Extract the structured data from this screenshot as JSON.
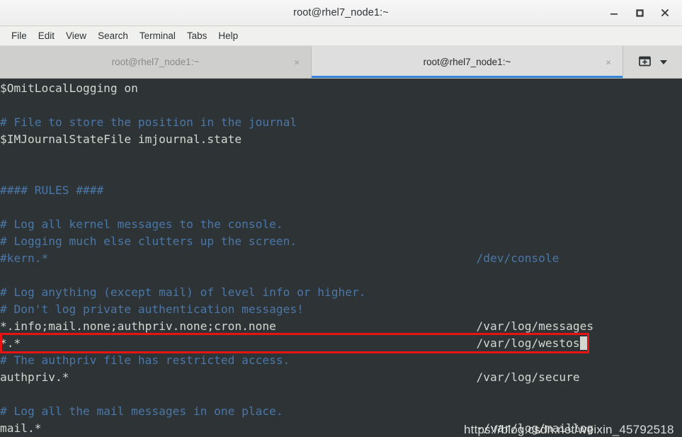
{
  "window": {
    "title": "root@rhel7_node1:~",
    "controls": {
      "minimize": "minimize",
      "maximize": "maximize",
      "close": "close"
    }
  },
  "menubar": {
    "items": [
      {
        "label": "File"
      },
      {
        "label": "Edit"
      },
      {
        "label": "View"
      },
      {
        "label": "Search"
      },
      {
        "label": "Terminal"
      },
      {
        "label": "Tabs"
      },
      {
        "label": "Help"
      }
    ]
  },
  "tabs": {
    "items": [
      {
        "label": "root@rhel7_node1:~",
        "active": false,
        "close": "×"
      },
      {
        "label": "root@rhel7_node1:~",
        "active": true,
        "close": "×"
      }
    ],
    "new_tab_icon": "new-tab-icon",
    "dropdown_icon": "chevron-down-icon"
  },
  "terminal": {
    "colors": {
      "background": "#2e3436",
      "foreground": "#d3d7cf",
      "comment": "#4a76a8",
      "highlight_border": "#e81313"
    },
    "lines": [
      {
        "left": "$OmitLocalLogging on",
        "right": "",
        "style": "white"
      },
      {
        "left": "",
        "right": "",
        "style": "white"
      },
      {
        "left": "# File to store the position in the journal",
        "right": "",
        "style": "blue"
      },
      {
        "left": "$IMJournalStateFile imjournal.state",
        "right": "",
        "style": "white"
      },
      {
        "left": "",
        "right": "",
        "style": "white"
      },
      {
        "left": "",
        "right": "",
        "style": "white"
      },
      {
        "left": "#### RULES ####",
        "right": "",
        "style": "blue"
      },
      {
        "left": "",
        "right": "",
        "style": "white"
      },
      {
        "left": "# Log all kernel messages to the console.",
        "right": "",
        "style": "blue"
      },
      {
        "left": "# Logging much else clutters up the screen.",
        "right": "",
        "style": "blue"
      },
      {
        "left": "#kern.*",
        "right": "/dev/console",
        "style": "blue"
      },
      {
        "left": "",
        "right": "",
        "style": "white"
      },
      {
        "left": "# Log anything (except mail) of level info or higher.",
        "right": "",
        "style": "blue"
      },
      {
        "left": "# Don't log private authentication messages!",
        "right": "",
        "style": "blue"
      },
      {
        "left": "*.info;mail.none;authpriv.none;cron.none",
        "right": "/var/log/messages",
        "style": "white"
      },
      {
        "left": "*.*",
        "right": "/var/log/westos",
        "style": "white",
        "cursor": true,
        "highlighted": true
      },
      {
        "left": "# The authpriv file has restricted access.",
        "right": "",
        "style": "blue"
      },
      {
        "left": "authpriv.*",
        "right": "/var/log/secure",
        "style": "white"
      },
      {
        "left": "",
        "right": "",
        "style": "white"
      },
      {
        "left": "# Log all the mail messages in one place.",
        "right": "",
        "style": "blue"
      },
      {
        "left": "mail.*",
        "right": "-/var/log/maillog",
        "style": "white"
      }
    ]
  },
  "watermark": {
    "text": "https://blog.csdn.net/weixin_45792518"
  }
}
